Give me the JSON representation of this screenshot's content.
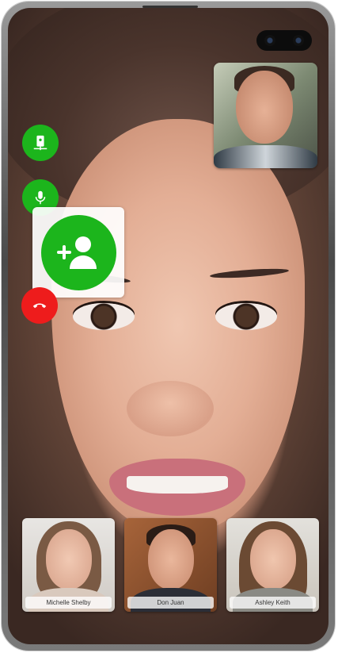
{
  "call": {
    "participants": [
      {
        "name": "Michelle Shelby"
      },
      {
        "name": "Don Juan"
      },
      {
        "name": "Ashley Keith"
      }
    ]
  },
  "controls": {
    "share_icon": "phone-share-icon",
    "mic_icon": "microphone-icon",
    "add_participant_icon": "add-user-icon",
    "end_call_icon": "end-call-icon"
  },
  "colors": {
    "accent_green": "#1cb51c",
    "end_call_red": "#ee1c1c"
  }
}
